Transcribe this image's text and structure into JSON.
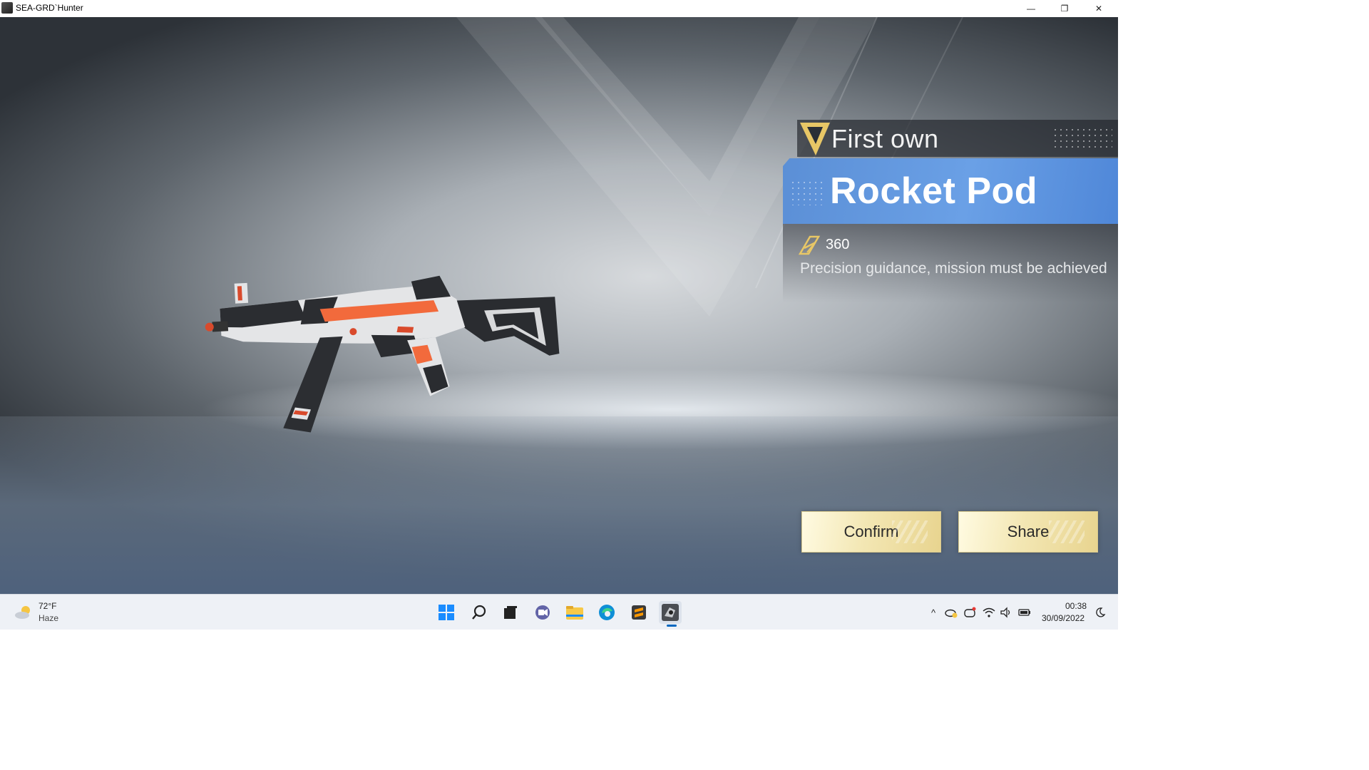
{
  "window": {
    "title": "SEA-GRD`Hunter",
    "controls": {
      "minimize": "—",
      "restore": "❐",
      "close": "✕"
    }
  },
  "reward": {
    "header": "First own",
    "item_name": "Rocket Pod",
    "score": "360",
    "description": "Precision guidance, mission must be achieved"
  },
  "buttons": {
    "confirm": "Confirm",
    "share": "Share"
  },
  "taskbar": {
    "weather": {
      "temp": "72°F",
      "condition": "Haze"
    },
    "apps": [
      "start-icon",
      "search-icon",
      "task-view-icon",
      "teams-chat-icon",
      "file-explorer-icon",
      "edge-icon",
      "sublime-icon",
      "game-app-icon"
    ],
    "clock": {
      "time": "00:38",
      "date": "30/09/2022"
    }
  },
  "colors": {
    "name_bar": "#5b8fd6",
    "button_gold": "#f3e7b4",
    "accent_gold": "#e8c766",
    "taskbar_bg": "#eef1f6"
  }
}
